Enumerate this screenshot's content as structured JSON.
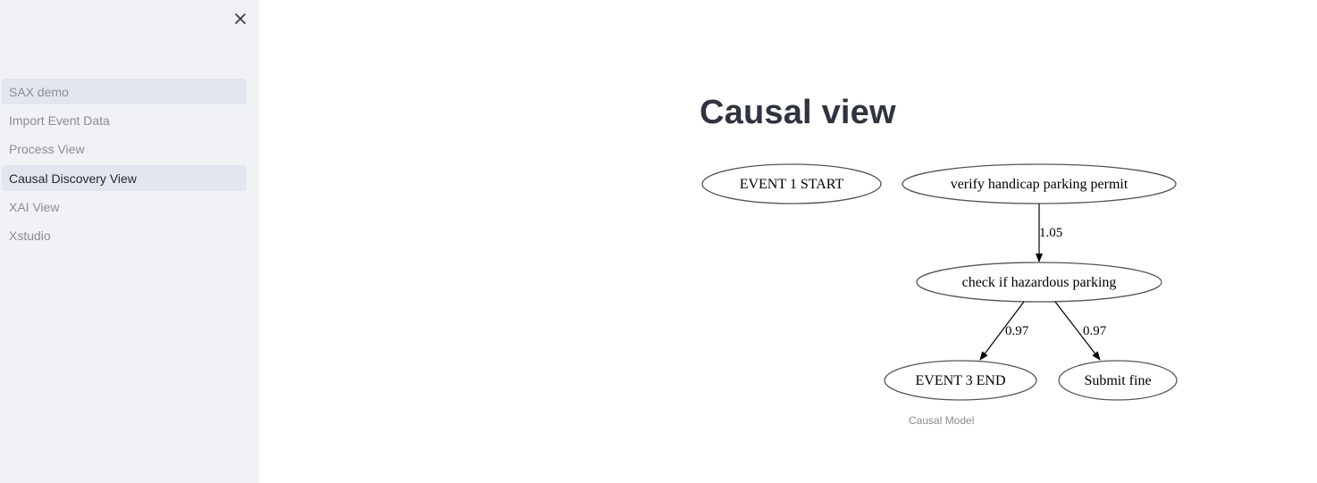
{
  "sidebar": {
    "close_icon": "close-icon",
    "items": [
      {
        "label": "SAX demo"
      },
      {
        "label": "Import Event Data"
      },
      {
        "label": "Process View"
      },
      {
        "label": "Causal Discovery View"
      },
      {
        "label": "XAI View"
      },
      {
        "label": "Xstudio"
      }
    ]
  },
  "main": {
    "title": "Causal view",
    "graph": {
      "nodes": {
        "event1_start": "EVENT 1 START",
        "verify_permit": "verify handicap parking permit",
        "check_hazardous": "check if hazardous parking",
        "event3_end": "EVENT 3 END",
        "submit_fine": "Submit fine"
      },
      "edges": {
        "verify_to_check": "1.05",
        "check_to_end": "0.97",
        "check_to_fine": "0.97"
      }
    },
    "caption": "Causal Model"
  }
}
